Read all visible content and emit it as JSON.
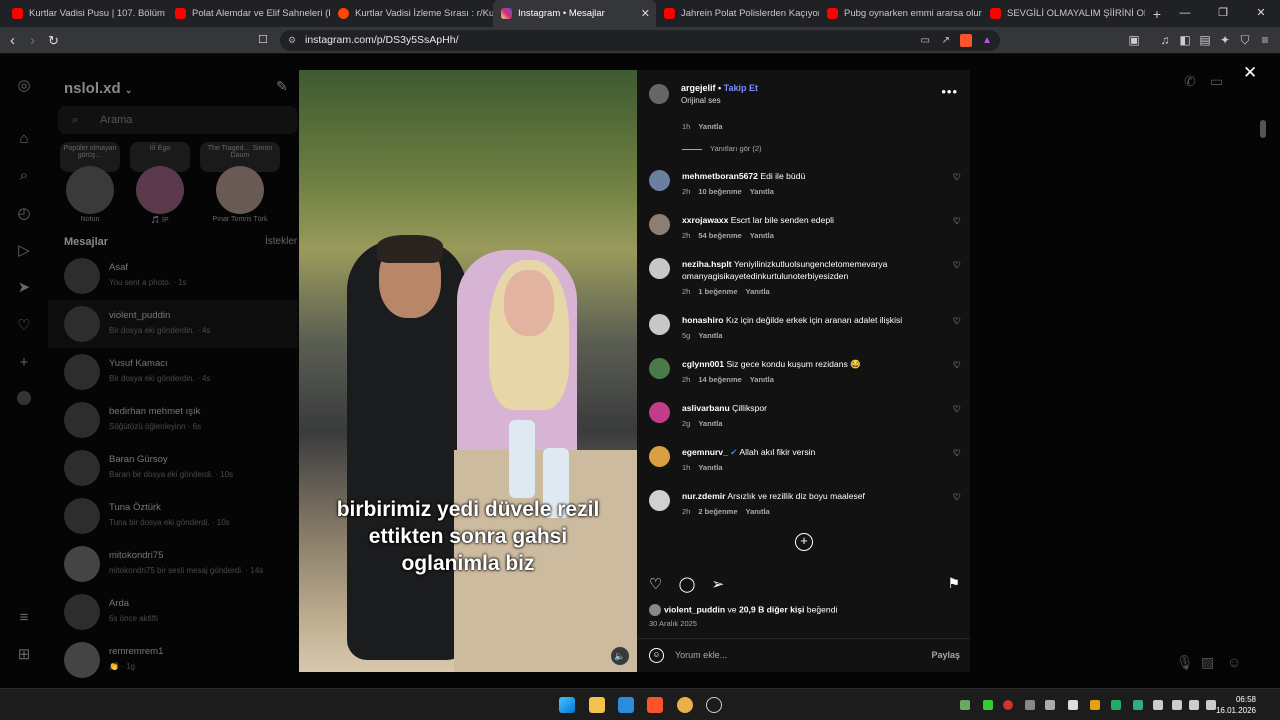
{
  "browser": {
    "tabs": [
      {
        "title": "Kurtlar Vadisi Pusu | 107. Bölüm | Yü…",
        "color": "#ff0000"
      },
      {
        "title": "Polat Alemdar ve Elif Sahneleri (Part…",
        "color": "#ff0000"
      },
      {
        "title": "Kurtlar Vadisi İzleme Sırası : r/Kurtlar…",
        "color": "#ff4500"
      },
      {
        "title": "Instagram • Mesajlar",
        "color": "#d6249f",
        "active": true
      },
      {
        "title": "Jahrein Polat Polislerden Kaçıyor (De…",
        "color": "#ff0000"
      },
      {
        "title": "Pubg oynarken emmi ararsa olur gib…",
        "color": "#ff0000"
      },
      {
        "title": "SEVGİLİ OLMAYALIM ŞİİRİNİ OKUYA…",
        "color": "#ff0000"
      }
    ],
    "new_tab": "+",
    "url": "instagram.com/p/DS3y5SsApHh/",
    "window_controls": [
      "—",
      "❐",
      "✕"
    ]
  },
  "dm": {
    "username": "nslol.xd",
    "search_placeholder": "Arama",
    "notes": [
      {
        "bubble": "Popüler olmayan görüş…",
        "name": "Notun"
      },
      {
        "bubble": "Iİİ Ego",
        "name": "🎵 İP"
      },
      {
        "bubble": "The Traged… Simon Daum",
        "name": "Pınar Tomris Türk"
      }
    ],
    "section_title": "Mesajlar",
    "requests": "İstekler",
    "chats": [
      {
        "name": "Asaf",
        "sub": "You sent a photo. · 1s"
      },
      {
        "name": "violent_puddin",
        "sub": "Bir dosya eki gönderdin. · 4s"
      },
      {
        "name": "Yusuf Kamacı",
        "sub": "Bir dosya eki gönderdin. · 4s"
      },
      {
        "name": "bedirhan mehmet ışık",
        "sub": "Söğütözü öğlenleyinn · 6s"
      },
      {
        "name": "Baran Gürsoy",
        "sub": "Baran bir dosya eki gönderdi. · 10s"
      },
      {
        "name": "Tuna Öztürk",
        "sub": "Tuna bir dosya eki gönderdi. · 10s"
      },
      {
        "name": "mitokondri75",
        "sub": "mitokondri75 bir sesli mesaj gönderdi. · 14s"
      },
      {
        "name": "Arda",
        "sub": "6s önce aktifti"
      },
      {
        "name": "remremrem1",
        "sub": "👏 · 1g"
      }
    ]
  },
  "post": {
    "caption": [
      "birbirimiz yedi düvele rezil",
      "ettikten sonra gahsi",
      "oglanimla biz"
    ],
    "author": "argejelif",
    "follow": "Takip Et",
    "audio": "Orijinal ses",
    "more": "•••",
    "first_meta": "1h",
    "reply_label": "Yanıtla",
    "view_replies": "Yanıtları gör (2)",
    "comments": [
      {
        "user": "mehmetboran5672",
        "text": "Edi ile büdü",
        "time": "2h",
        "likes": "10 beğenme",
        "avatar": "#6a7fa0"
      },
      {
        "user": "xxrojawaxx",
        "text": "Escrt lar bile senden edepli",
        "time": "2h",
        "likes": "54 beğenme",
        "avatar": "#8a7f72"
      },
      {
        "user": "neziha.hsplt",
        "text": "Yeniyilinizkutluolsungencletomemevarya omanyagisikayetedinkurtulunoterbiyesizden",
        "time": "2h",
        "likes": "1 beğenme",
        "avatar": "#c8c8c8"
      },
      {
        "user": "honashiro",
        "text": "Kız için değilde erkek için aranan adalet ilişkisi",
        "time": "5g",
        "likes": "",
        "avatar": "#c8c8c8"
      },
      {
        "user": "cglynn001",
        "text": "Siz gece kondu kuşum rezidans 😂",
        "time": "2h",
        "likes": "14 beğenme",
        "avatar": "#4a7a4a"
      },
      {
        "user": "aslivarbanu",
        "text": "Çillikspor",
        "time": "2g",
        "likes": "",
        "avatar": "#c23c8a"
      },
      {
        "user": "egemnurv_",
        "text": "Allah akıl fikir versin",
        "time": "1h",
        "likes": "",
        "avatar": "#d8a040",
        "verified": "✔"
      },
      {
        "user": "nur.zdemir",
        "text": "Arsızlık ve rezillik diz boyu maalesef",
        "time": "2h",
        "likes": "2 beğenme",
        "avatar": "#d0d0d0"
      }
    ],
    "likes_user": "violent_puddin",
    "likes_rest": " ve ",
    "likes_count": "20,9 B diğer kişi",
    "likes_suffix": " beğendi",
    "date": "30 Aralık 2025",
    "comment_placeholder": "Yorum ekle...",
    "share": "Paylaş",
    "close": "✕"
  },
  "taskbar": {
    "time": "06:58",
    "date": "16.01.2026"
  }
}
